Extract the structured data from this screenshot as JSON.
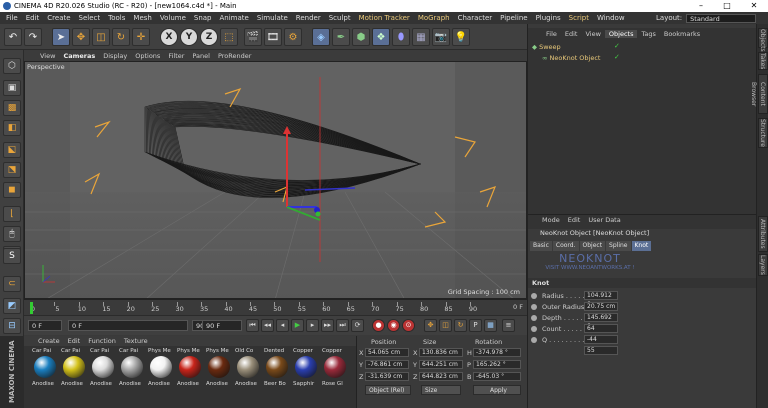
{
  "window": {
    "title": "CINEMA 4D R20.026 Studio (RC - R20) - [new1064.c4d *] - Main",
    "minimize": "–",
    "maximize": "□",
    "close": "✕"
  },
  "menu": {
    "items": [
      "File",
      "Edit",
      "Create",
      "Select",
      "Tools",
      "Mesh",
      "Volume",
      "Snap",
      "Animate",
      "Simulate",
      "Render",
      "Sculpt",
      "Motion Tracker",
      "MoGraph",
      "Character",
      "Pipeline",
      "Plugins",
      "Script",
      "Window"
    ],
    "layout_label": "Layout:",
    "layout_value": "Standard"
  },
  "viewport": {
    "menu": [
      "View",
      "Cameras",
      "Display",
      "Options",
      "Filter",
      "Panel",
      "ProRender"
    ],
    "camera_label": "Perspective",
    "grid_spacing": "Grid Spacing : 100 cm"
  },
  "timeline": {
    "ticks": [
      "0",
      "5",
      "10",
      "15",
      "20",
      "25",
      "30",
      "35",
      "40",
      "45",
      "50",
      "55",
      "60",
      "65",
      "70",
      "75",
      "80",
      "85",
      "90"
    ],
    "end_label": "0 F"
  },
  "transport": {
    "current_frame": "0 F",
    "start_frame": "0 F",
    "end_frame": "90 F",
    "max_frame": "90 F"
  },
  "materials": {
    "menu": [
      "Create",
      "Edit",
      "Function",
      "Texture"
    ],
    "items": [
      {
        "top": "Car Pai",
        "bottom": "Anodise",
        "color": "#1a7fc0"
      },
      {
        "top": "Car Pai",
        "bottom": "Anodise",
        "color": "#d4c21a"
      },
      {
        "top": "Car Pai",
        "bottom": "Anodise",
        "color": "#dcdcdc"
      },
      {
        "top": "Car Pai",
        "bottom": "Anodise",
        "color": "#a8a8a8"
      },
      {
        "top": "Phys Me",
        "bottom": "Anodise",
        "color": "#f2f2f2"
      },
      {
        "top": "Phys Me",
        "bottom": "Anodise",
        "color": "#c8241a"
      },
      {
        "top": "Phys Me",
        "bottom": "Anodise",
        "color": "#6a2a10"
      },
      {
        "top": "Old Co",
        "bottom": "Anodise",
        "color": "#9a8f7a"
      },
      {
        "top": "Dented",
        "bottom": "Beer Bo",
        "color": "#7a4a1a"
      },
      {
        "top": "Copper",
        "bottom": "Sapphir",
        "color": "#2a3fb0"
      },
      {
        "top": "Copper",
        "bottom": "Rose Gl",
        "color": "#9a2a3a"
      }
    ],
    "logo": "MAXON CINEMA 4D"
  },
  "coordinates": {
    "headers": [
      "Position",
      "Size",
      "Rotation"
    ],
    "rows": [
      {
        "axis": "X",
        "pos": "54.065 cm",
        "size_axis": "X",
        "size": "130.836 cm",
        "rot_axis": "H",
        "rot": "-374.978 °"
      },
      {
        "axis": "Y",
        "pos": "-76.861 cm",
        "size_axis": "Y",
        "size": "644.251 cm",
        "rot_axis": "P",
        "rot": "165.262 °"
      },
      {
        "axis": "Z",
        "pos": "-31.639 cm",
        "size_axis": "Z",
        "size": "644.823 cm",
        "rot_axis": "B",
        "rot": "-645.03 °"
      }
    ],
    "mode": "Object (Rel)",
    "size_mode": "Size",
    "apply": "Apply"
  },
  "objects": {
    "tabs": [
      "File",
      "Edit",
      "View",
      "Objects",
      "Tags",
      "Bookmarks"
    ],
    "items": [
      {
        "name": "Sweep",
        "indent": 0
      },
      {
        "name": "NeoKnot Object",
        "indent": 1
      }
    ]
  },
  "attributes": {
    "menu": [
      "Mode",
      "Edit",
      "User Data"
    ],
    "title": "NeoKnot Object [NeoKnot Object]",
    "tabs": [
      "Basic",
      "Coord.",
      "Object",
      "Spline",
      "Knot"
    ],
    "watermark_line1": "NEOKNOT",
    "watermark_line2": "VISIT WWW.NEOANTWORKS.AT !",
    "section": "Knot",
    "params": [
      {
        "label": "Radius . . . . . .",
        "value": "104.912 c"
      },
      {
        "label": "Outer Radius",
        "value": "20.75 cm"
      },
      {
        "label": "Depth . . . . . .",
        "value": "145.692 c"
      },
      {
        "label": "Count . . . . . .",
        "value": "64"
      },
      {
        "label": "Q . . . . . . . . .",
        "value": "-44"
      },
      {
        "label": "",
        "value": "55"
      }
    ]
  },
  "side_tabs": [
    "Objects",
    "Takes",
    "Content Browser",
    "Structure",
    "Attributes",
    "Layers"
  ],
  "colors": {
    "accent": "#e8c87a",
    "selected": "#5b6f94",
    "orange": "#e9a53a"
  }
}
